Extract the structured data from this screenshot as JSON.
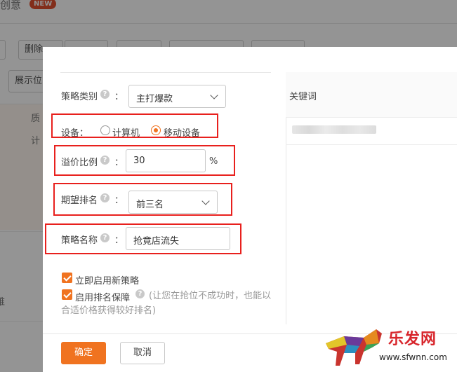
{
  "background": {
    "page_title": "创意",
    "badge": "NEW",
    "toolbar_delete": "删除",
    "filter_display": "展示位",
    "col_quality": "质",
    "col_plan": "计",
    "row_fragment": "维"
  },
  "modal": {
    "form": {
      "strategy_type": {
        "label": "策略类别",
        "colon": "：",
        "value": "主打爆款"
      },
      "device": {
        "label": "设备：",
        "options": [
          "计算机",
          "移动设备"
        ],
        "selected": "移动设备"
      },
      "premium_ratio": {
        "label": "溢价比例",
        "colon": "：",
        "value": "30",
        "unit": "%"
      },
      "expected_rank": {
        "label": "期望排名",
        "colon": "：",
        "value": "前三名"
      },
      "strategy_name": {
        "label": "策略名称",
        "colon": "：",
        "value": "抢竟店流失"
      },
      "enable_now": {
        "label": "立即启用新策略",
        "checked": true
      },
      "rank_guard": {
        "label": "启用排名保障",
        "hint": "(让您在抢位不成功时，也能以合适价格获得较好排名)",
        "checked": true
      }
    },
    "keyword_panel": {
      "header": "关键词"
    },
    "footer": {
      "ok_label": "确定",
      "cancel_label": "取消"
    }
  },
  "watermark": {
    "text": "乐发网",
    "url": "www.sfwnn.com"
  },
  "colors": {
    "accent": "#f07320",
    "highlight_box": "#e8201d",
    "overlay": "rgba(0,0,0,0.42)"
  },
  "icons": {
    "help": "question-circle-icon",
    "dropdown": "chevron-down-icon",
    "check": "checkmark-icon"
  }
}
